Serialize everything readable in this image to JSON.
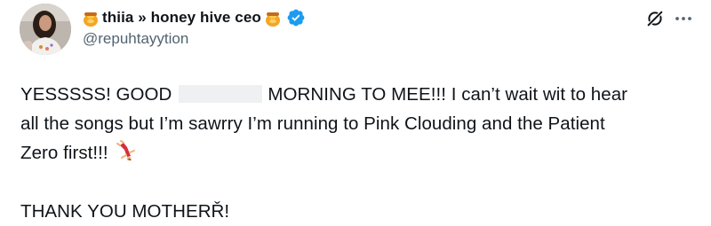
{
  "author": {
    "display_name": "thiia » honey hive ceo",
    "handle": "@repuhtayytion",
    "name_prefix_icon": "honey-pot-icon",
    "name_suffix_icon": "honey-pot-icon",
    "verified_icon": "verified-badge-icon",
    "verified_color": "#1d9bf0"
  },
  "actions": {
    "grok_icon": "grok-icon",
    "more_icon": "more-options-icon"
  },
  "tweet": {
    "line1_before": "YESSSSS! GOOD",
    "line1_after": "MORNING TO MEE!!! I can’t wait wit to hear",
    "line2": "all the songs but I’m sawrry I’m running to Pink Clouding and the Patient",
    "line3": "Zero first!!!",
    "line3_icon": "dancer-icon",
    "line5": "THANK YOU MOTHERŘ!"
  },
  "colors": {
    "text": "#0f1419",
    "secondary": "#536471",
    "redaction": "#eef0f2"
  }
}
